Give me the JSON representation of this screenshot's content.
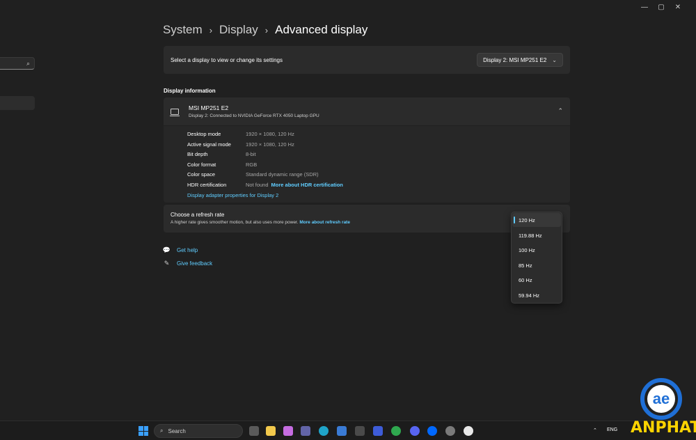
{
  "window": {
    "minimize": "—",
    "maximize": "▢",
    "close": "✕"
  },
  "breadcrumb": {
    "items": [
      "System",
      "Display"
    ],
    "current": "Advanced display",
    "sep": "›"
  },
  "select_display": {
    "label": "Select a display to view or change its settings",
    "value": "Display 2: MSI MP251 E2"
  },
  "display_info": {
    "section_title": "Display information",
    "name": "MSI MP251 E2",
    "subtitle": "Display 2: Connected to NVIDIA GeForce RTX 4050 Laptop GPU",
    "properties": [
      {
        "key": "Desktop mode",
        "value": "1920 × 1080, 120 Hz"
      },
      {
        "key": "Active signal mode",
        "value": "1920 × 1080, 120 Hz"
      },
      {
        "key": "Bit depth",
        "value": "8-bit"
      },
      {
        "key": "Color format",
        "value": "RGB"
      },
      {
        "key": "Color space",
        "value": "Standard dynamic range (SDR)"
      },
      {
        "key": "HDR certification",
        "value": "Not found",
        "link": "More about HDR certification"
      }
    ],
    "adapter_link": "Display adapter properties for Display 2"
  },
  "refresh_rate": {
    "title": "Choose a refresh rate",
    "description": "A higher rate gives smoother motion, but also uses more power.",
    "link": "More about refresh rate",
    "options": [
      "120 Hz",
      "119.88 Hz",
      "100 Hz",
      "85 Hz",
      "60 Hz",
      "59.94 Hz"
    ],
    "selected": "120 Hz"
  },
  "help": {
    "get_help": "Get help",
    "feedback": "Give feedback"
  },
  "taskbar": {
    "search_placeholder": "Search",
    "lang": "ENG"
  },
  "watermark": {
    "text": "ANPHAT",
    "glyph": "ae"
  },
  "colors": {
    "accent": "#60cdff",
    "background": "#202020",
    "card": "#2b2b2b",
    "watermark_blue": "#1f6fd6",
    "watermark_yellow": "#ffd400"
  }
}
